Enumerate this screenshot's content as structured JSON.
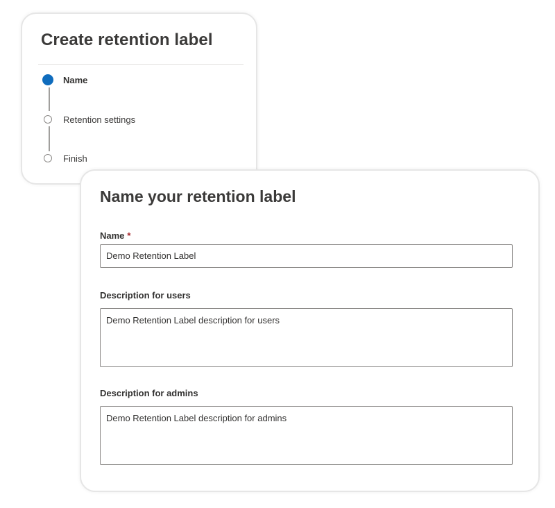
{
  "wizard": {
    "title": "Create retention label",
    "steps": [
      {
        "label": "Name",
        "state": "current"
      },
      {
        "label": "Retention settings",
        "state": "pending"
      },
      {
        "label": "Finish",
        "state": "pending"
      }
    ]
  },
  "form": {
    "title": "Name your retention label",
    "name": {
      "label": "Name",
      "required_mark": "*",
      "value": "Demo Retention Label"
    },
    "description_users": {
      "label": "Description for users",
      "value": "Demo Retention Label description for users"
    },
    "description_admins": {
      "label": "Description for admins",
      "value": "Demo Retention Label description for admins"
    }
  },
  "colors": {
    "accent": "#0f6cbd",
    "required": "#a4262c",
    "input_border": "#8a8886"
  }
}
